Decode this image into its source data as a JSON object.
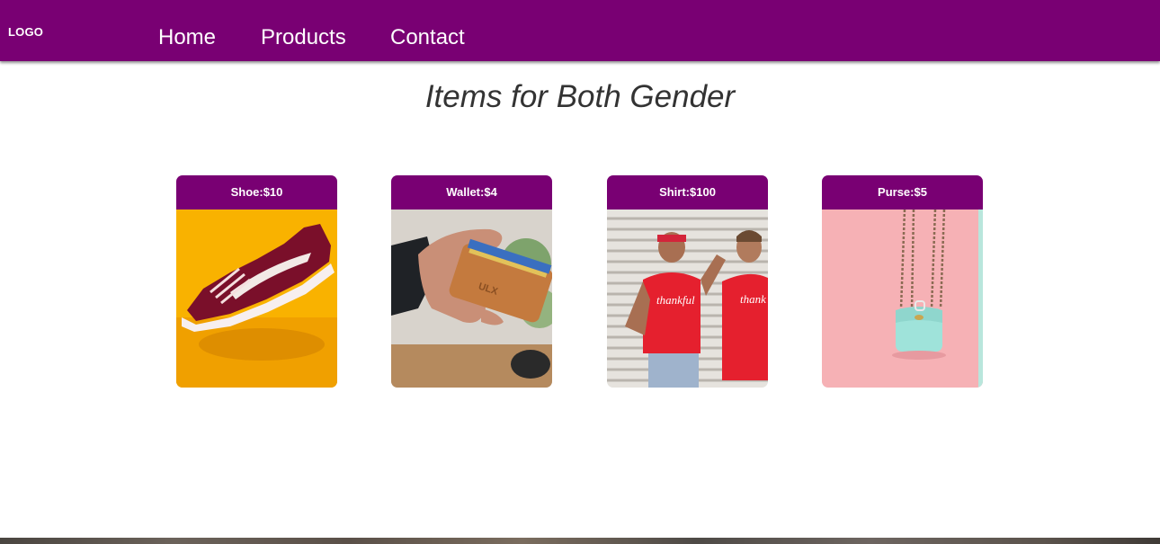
{
  "nav": {
    "logo": "LOGO",
    "links": [
      "Home",
      "Products",
      "Contact"
    ]
  },
  "main": {
    "heading": "Items for Both Gender",
    "products": [
      {
        "label": "Shoe:$10",
        "image": "red-sneaker-on-yellow"
      },
      {
        "label": "Wallet:$4",
        "image": "hand-holding-leather-wallet"
      },
      {
        "label": "Shirt:$100",
        "image": "couple-in-red-shirts"
      },
      {
        "label": "Purse:$5",
        "image": "mint-purse-on-pink"
      }
    ]
  },
  "colors": {
    "brand": "#790073",
    "heading_text": "#333333",
    "background": "#ffffff"
  }
}
